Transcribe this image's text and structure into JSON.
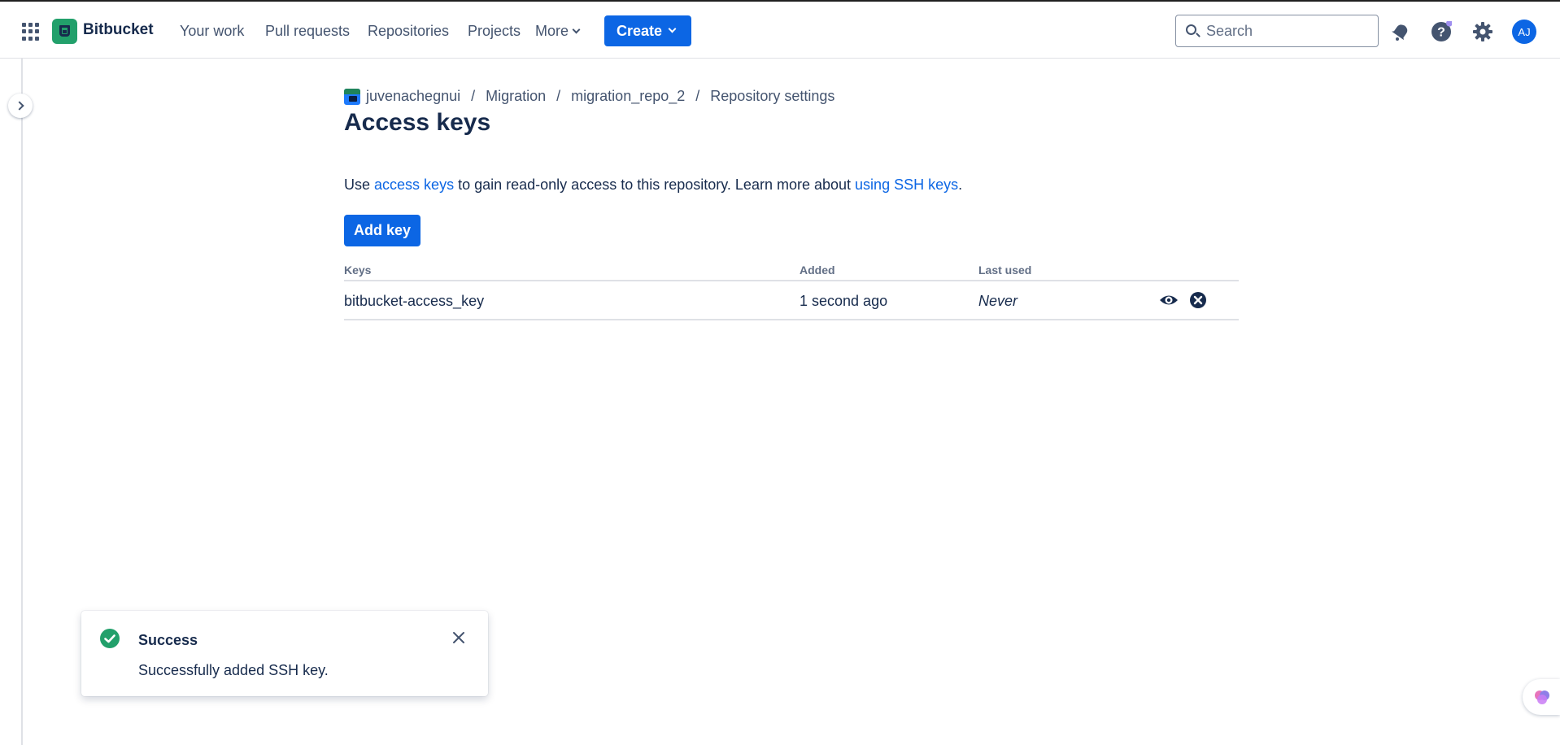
{
  "nav": {
    "brand": "Bitbucket",
    "your_work": "Your work",
    "pull_requests": "Pull requests",
    "repositories": "Repositories",
    "projects": "Projects",
    "more": "More",
    "create": "Create",
    "search_placeholder": "Search",
    "avatar_initials": "AJ"
  },
  "breadcrumb": {
    "workspace": "juvenachegnui",
    "project": "Migration",
    "repo": "migration_repo_2",
    "page": "Repository settings",
    "separator": "/"
  },
  "page": {
    "title": "Access keys",
    "intro_prefix": "Use",
    "intro_link1": "access keys",
    "intro_middle": "to gain read-only access to this repository. Learn more about",
    "intro_link2": "using SSH keys",
    "intro_suffix": ".",
    "add_key": "Add key"
  },
  "table": {
    "headers": {
      "keys": "Keys",
      "added": "Added",
      "last_used": "Last used"
    },
    "rows": [
      {
        "name": "bitbucket-access_key",
        "added": "1 second ago",
        "last_used": "Never"
      }
    ]
  },
  "toast": {
    "title": "Success",
    "message": "Successfully added SSH key."
  },
  "colors": {
    "brand_blue": "#0c66e4",
    "success_green": "#22a06b",
    "text": "#172b4d"
  },
  "icons": [
    "app-switcher-icon",
    "bitbucket-logo-icon",
    "search-icon",
    "notifications-icon",
    "help-icon",
    "settings-icon",
    "view-icon",
    "delete-icon",
    "success-icon",
    "close-icon",
    "expand-sidebar-icon",
    "assistant-icon"
  ]
}
